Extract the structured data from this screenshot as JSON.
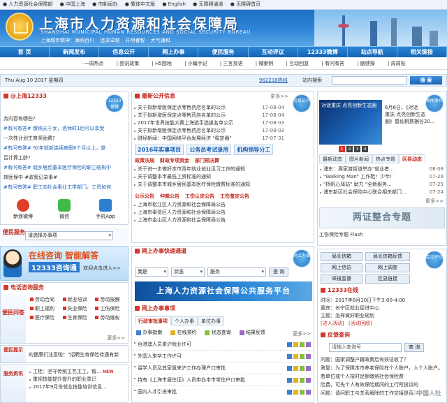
{
  "topbar": [
    "人力资源社会保障部",
    "中国上海",
    "市新闻办",
    "繁体中文版",
    "English",
    "无障碍通道",
    "无障碍首页"
  ],
  "banner": {
    "title": "上海市人力资源和社会保障局",
    "subtitle": "SHANGHAI MUNICIPAL HUMAN RESOURCES AND SOCIAL SECURITY BUREAU",
    "slogan": "上海城市精神：海纳百川 追求卓越 开明睿智 大气谦和"
  },
  "nav": [
    "首 页",
    "新闻发布",
    "信息公开",
    "网上办事",
    "便民服务",
    "互动评议",
    "12333微博",
    "站点导航",
    "相关链接"
  ],
  "subnav": [
    "一周热点",
    "图说政策",
    "H5图地",
    "小编手记",
    "三言良语",
    "微案例",
    "互动回复",
    "有问有答",
    "脑健操",
    "周周贴"
  ],
  "datebar": {
    "date": "Thu Aug 10 2017 星期四",
    "hotline": "962218热线",
    "search_label": "站内搜索",
    "search_placeholder": "",
    "search_button": "搜 索"
  },
  "weibo": {
    "title": "@上海12333",
    "badge": "12333微博",
    "posts": [
      "务内容有哪些?",
      "#有问有答# 缴纳无于女，退休时1后可以享受",
      "一次性计划生育奖励费?",
      "#有问有答# 92年就新连续病假6个月以上，是",
      "否计算工龄?",
      "#有问有答# 城乡居民基本医疗保险的职工结构中",
      "转医保中 #政策记录事#",
      "#有问有答# 职工向社会事业工学部门，工资如何"
    ],
    "icons": [
      "新浪微博",
      "微信",
      "手机App"
    ]
  },
  "gov": {
    "title": "最新公开信息",
    "badge": "信息公开",
    "more": "更多>>",
    "items": [
      {
        "t": "关于拟新增医保定点零售药店名单的公示",
        "d": "17-08-04"
      },
      {
        "t": "关于拟新增医保定点零售药店名单的公示",
        "d": "17-08-04"
      },
      {
        "t": "2017年世界技能大赛上海选手选拔名单公示",
        "d": "17-08-03"
      },
      {
        "t": "关于拟新增医保定点零售药店名单的公示",
        "d": "17-08-03"
      },
      {
        "t": "财经新闻：中国网络平台发展经济 \"稳定器\"",
        "d": "17-07-31"
      }
    ],
    "banners": [
      "2016年实事项目",
      "公务员考试录用",
      "机构领导分工"
    ],
    "sections": [
      {
        "name": "政策法规",
        "tabs": [
          "财政专项资金",
          "部门预决算"
        ],
        "items": [
          "关于进一步做好本市青年就业创业见习工作的通知",
          "关于调整本市最低工资标准的通知",
          "关于调整本市城乡居民基本医疗保险缴费标准的通知"
        ]
      },
      {
        "name": "公示公告",
        "tabs": [
          "仲裁公告",
          "工伤认定公告",
          "工伤鉴定公告"
        ],
        "items": [
          "上海市松江区人力资源和社会保障局公告",
          "上海市奉贤区人力资源和社会保障局公告",
          "上海市金山区人力资源和社会保障局公告"
        ]
      }
    ]
  },
  "news": {
    "badge": "新闻发布",
    "caption": "对话重庆·点亮创新生态圈",
    "slide_text": [
      "6月6日，《对话",
      "重庆·点亮创新生态",
      "圈》暨仙桃数据谷20..."
    ],
    "pages": [
      "1",
      "2",
      "3",
      "4"
    ],
    "tabs": [
      "最新动态",
      "图片新闻",
      "热点专题",
      "区县动态"
    ],
    "items": [
      {
        "t": "浦东：周家渡街道举办\"就业者...",
        "d": "08-08"
      },
      {
        "t": "\"Walking Man\" 工作鞋！少年!",
        "d": "07-26"
      },
      {
        "t": "\"扬帆心驿站\" 助力 \"全新服务...",
        "d": "07-25"
      },
      {
        "t": "浦东新区社会保险中心联合相关部门...",
        "d": "07-24"
      }
    ],
    "more": "更多>>",
    "promo": "两证整合专题",
    "flash": "工伤保险专题 Flash"
  },
  "service": {
    "label": "便民服务",
    "select_placeholder": "请选择办事项",
    "online_title": "在线咨询 智能解答",
    "online_sub": "12333咨询通",
    "online_enter": "欢迎点击进入>>",
    "phone_title": "电话咨询服务",
    "phone_label": "便民问答",
    "grid": [
      "劳动合同",
      "就业培训",
      "劳动报酬",
      "职工福利",
      "失业保险",
      "工伤保险",
      "医疗保险",
      "生育保险",
      "劳动维权"
    ],
    "more": "更多>>",
    "tip_label": "便民提示",
    "tip_text": "的健康们注意啦！\"招聘生育保险待遇有新",
    "guide_label": "服务资讯",
    "guide_items": [
      "工桂：坚守传统工艺主工，智...",
      "重视技能提升提升的职业意识",
      "2017年9月份就业技能培训信息..."
    ]
  },
  "online": {
    "title": "网上办事快速通道",
    "badge": "网上办事",
    "selects": [
      "我是",
      "状态",
      "服务"
    ],
    "query_button": "查 询",
    "platform": "上海人力资源社会保障公共服务平台",
    "items_title": "网上办事事项",
    "tabs": [
      "行政审批事项",
      "个人办事",
      "单位办事"
    ],
    "legend": [
      "办事指南",
      "在线预约",
      "状态查询",
      "结果反馈"
    ],
    "rows": [
      "台港澳人员来沪就业许可",
      "外国人来华工作许可",
      "留学人员及其家属来沪工作办理户口审批",
      "持有《上海市居住证》人员申办本市常住户口审批",
      "国内人才引进审批"
    ],
    "more": "更多>>"
  },
  "interact": {
    "badge": "互动评议",
    "buttons": [
      "局长信箱",
      "局长信箱反馈",
      "网上信访",
      "网上调查",
      "举报监督",
      "区县链接"
    ],
    "online_title": "12333在线",
    "online_time": "时间：2017年8月10日下午3:00-4:00",
    "guest": "嘉宾：长宁区就业促进中心",
    "topic": "主题：怎样做好职业规划",
    "enter": "[进入活动]",
    "review": "[活动回顾]",
    "feedback_title": "反馈查询",
    "feedback_placeholder": "请输入查询号",
    "feedback_button": "查 询",
    "feedback_text": [
      "问题：国家调整户籍政策后有效征收了？",
      "答复：为了保障本市养老保险在个人账户，入个人账户。",
      "若单位或个人按时足额缴纳社会保险费",
      "险费，可先个人有效保险期间的工行所投诉的",
      "问题：请问职工与关系解除的工作交接是否属于劳"
    ],
    "watermark": "中国人社"
  }
}
